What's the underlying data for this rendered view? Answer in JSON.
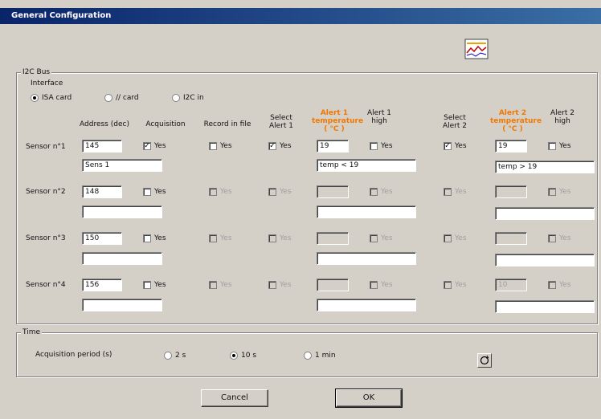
{
  "window": {
    "title": "General Configuration"
  },
  "i2c": {
    "group_label": "I2C Bus",
    "interface_label": "Interface",
    "interfaces": [
      {
        "label": "ISA card",
        "selected": true
      },
      {
        "label": "// card",
        "selected": false
      },
      {
        "label": "I2C in",
        "selected": false
      }
    ],
    "headers": {
      "address": "Address (dec)",
      "acquisition": "Acquisition",
      "record": "Record in file",
      "select_alert1": "Select\nAlert 1",
      "alert1_temp": "Alert 1\ntemperature\n( °C )",
      "alert1_high": "Alert 1\nhigh",
      "select_alert2": "Select\nAlert 2",
      "alert2_temp": "Alert 2\ntemperature\n( °C )",
      "alert2_high": "Alert 2\nhigh"
    },
    "yes_label": "Yes",
    "sensors": [
      {
        "label": "Sensor n°1",
        "address": "145",
        "name": "Sens 1",
        "acquisition": true,
        "record": false,
        "select_alert1": true,
        "alert1_temp": "19",
        "alert1_high": false,
        "alert1_text": "temp < 19",
        "select_alert2": true,
        "alert2_temp": "19",
        "alert2_high": false,
        "alert2_text": "temp > 19"
      },
      {
        "label": "Sensor n°2",
        "address": "148",
        "name": "",
        "acquisition": false,
        "record": false,
        "select_alert1": false,
        "alert1_temp": "",
        "alert1_high": false,
        "alert1_text": "",
        "select_alert2": false,
        "alert2_temp": "",
        "alert2_high": false,
        "alert2_text": ""
      },
      {
        "label": "Sensor n°3",
        "address": "150",
        "name": "",
        "acquisition": false,
        "record": false,
        "select_alert1": false,
        "alert1_temp": "",
        "alert1_high": false,
        "alert1_text": "",
        "select_alert2": false,
        "alert2_temp": "",
        "alert2_high": false,
        "alert2_text": ""
      },
      {
        "label": "Sensor n°4",
        "address": "156",
        "name": "",
        "acquisition": false,
        "record": false,
        "select_alert1": false,
        "alert1_temp": "",
        "alert1_high": false,
        "alert1_text": "",
        "select_alert2": false,
        "alert2_temp": "10",
        "alert2_high": false,
        "alert2_text": ""
      }
    ]
  },
  "time": {
    "group_label": "Time",
    "period_label": "Acquisition period (s)",
    "options": [
      {
        "label": "2 s",
        "selected": false
      },
      {
        "label": "10 s",
        "selected": true
      },
      {
        "label": "1 min",
        "selected": false
      }
    ]
  },
  "buttons": {
    "cancel": "Cancel",
    "ok": "OK"
  },
  "icons": {
    "top_right": "chart-icon",
    "time_button": "refresh-icon"
  }
}
